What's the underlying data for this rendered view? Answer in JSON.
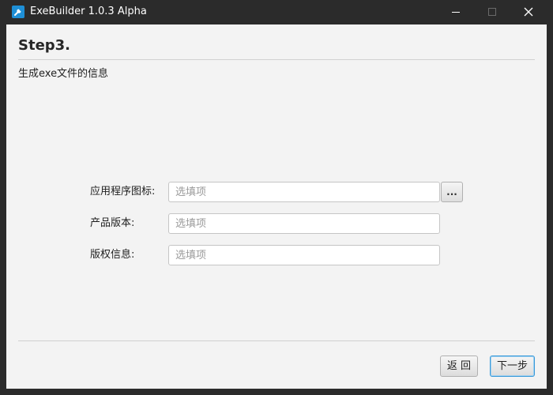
{
  "window": {
    "title": "ExeBuilder 1.0.3 Alpha",
    "icon": "wrench-icon",
    "controls": [
      "minimize-icon",
      "maximize-icon",
      "close-icon"
    ]
  },
  "page": {
    "step_title": "Step3.",
    "subtitle": "生成exe文件的信息"
  },
  "form": {
    "fields": [
      {
        "label": "应用程序图标:",
        "value": "",
        "placeholder": "选填项"
      },
      {
        "label": "产品版本:",
        "value": "",
        "placeholder": "选填项"
      },
      {
        "label": "版权信息:",
        "value": "",
        "placeholder": "选填项"
      }
    ],
    "browse_label": "..."
  },
  "footer": {
    "back_label": "返 回",
    "next_label": "下一步"
  },
  "colors": {
    "titlebar": "#2b2b2b",
    "client_bg": "#f3f3f3",
    "accent": "#3a9ad9",
    "app_icon": "#1e8fd6"
  }
}
